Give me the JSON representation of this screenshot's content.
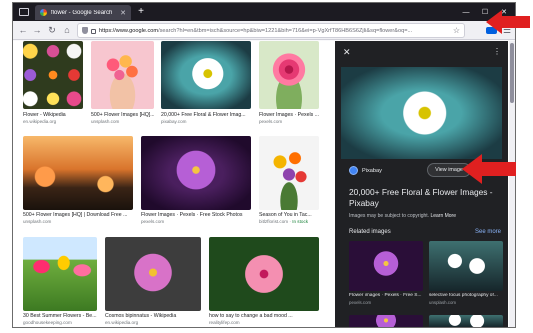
{
  "browser": {
    "tab_title": "flower - Google Search",
    "new_tab": "+",
    "url_host": "https://www.google.com",
    "url_rest": "/search?hl=en&tbm=isch&source=hp&biw=1221&bih=716&ei=p-VgXrfT86HB6S6ZjIi&sq=flower&oq=...",
    "win_minimize": "—",
    "win_maximize": "☐",
    "win_close": "✕",
    "back": "←",
    "forward": "→",
    "reload": "↻",
    "home": "⌂",
    "star": "☆",
    "menu": "☰",
    "tab_close": "✕"
  },
  "results": [
    {
      "caption": "Flower - Wikipedia",
      "source": "en.wikipedia.org"
    },
    {
      "caption": "500+ Flower Images [HQ]...",
      "source": "unsplash.com"
    },
    {
      "caption": "20,000+ Free Floral & Flower Imag...",
      "source": "pixabay.com"
    },
    {
      "caption": "Flower Images · Pexels ...",
      "source": "pexels.com"
    },
    {
      "caption": "500+ Flower Images [HQ] | Download Free ...",
      "source": "unsplash.com"
    },
    {
      "caption": "Flower Images · Pexels · Free Stock Photos",
      "source": "pexels.com"
    },
    {
      "caption": "Season of You in Tac...",
      "source": "bitlzflorist.com",
      "stock": "In stock"
    },
    {
      "caption": "30 Best Summer Flowers - Be...",
      "source": "goodhousekeeping.com"
    },
    {
      "caption": "Cosmos bipinnatus - Wikipedia",
      "source": "en.wikipedia.org"
    },
    {
      "caption": "how to say to change a bad mood ...",
      "source": "realitylifep.com"
    }
  ],
  "panel": {
    "close": "✕",
    "more": "⋮",
    "source_name": "Pixabay",
    "view_button": "View image",
    "title": "20,000+ Free Floral & Flower Images - Pixabay",
    "copyright": "Images may be subject to copyright.",
    "learn_more": "Learn More",
    "related_label": "Related images",
    "see_more": "See more",
    "related": [
      {
        "caption": "Flower images · Pexels · Free S...",
        "source": "pexels.com"
      },
      {
        "caption": "selective focus photography of...",
        "source": "unsplash.com"
      }
    ]
  },
  "colors": {
    "annotation": "#e02020",
    "accent": "#8ab4f8"
  },
  "icons": [
    "flower-favicon",
    "shield-icon",
    "lock-icon",
    "star-icon",
    "menu-icon",
    "back-icon",
    "forward-icon",
    "reload-icon",
    "home-icon",
    "close-icon",
    "more-icon",
    "pixabay-logo"
  ]
}
